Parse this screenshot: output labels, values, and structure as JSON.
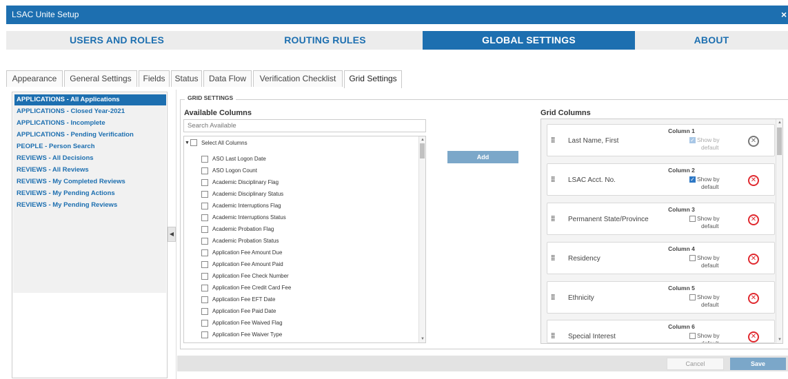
{
  "window": {
    "title": "LSAC Unite Setup",
    "close_glyph": "×"
  },
  "nav": {
    "users_roles": "USERS AND ROLES",
    "routing_rules": "ROUTING RULES",
    "global_settings": "GLOBAL SETTINGS",
    "about": "ABOUT",
    "active": "GLOBAL SETTINGS"
  },
  "tabs": [
    "Appearance",
    "General Settings",
    "Fields",
    "Status",
    "Data Flow",
    "Verification Checklist",
    "Grid Settings"
  ],
  "active_tab": "Grid Settings",
  "sidebar": {
    "items": [
      "APPLICATIONS - All Applications",
      "APPLICATIONS - Closed Year-2021",
      "APPLICATIONS - Incomplete",
      "APPLICATIONS - Pending Verification",
      "PEOPLE - Person Search",
      "REVIEWS - All Decisions",
      "REVIEWS - All Reviews",
      "REVIEWS - My Completed Reviews",
      "REVIEWS - My Pending Actions",
      "REVIEWS - My Pending Reviews"
    ],
    "selected": "APPLICATIONS - All Applications"
  },
  "grid_settings": {
    "legend": "GRID SETTINGS",
    "available_title": "Available Columns",
    "search_placeholder": "Search Available",
    "select_all": "Select All Columns",
    "available_columns": [
      "ASO Last Logon Date",
      "ASO Logon Count",
      "Academic Disciplinary Flag",
      "Academic Disciplinary Status",
      "Academic Interruptions Flag",
      "Academic Interruptions Status",
      "Academic Probation Flag",
      "Academic Probation Status",
      "Application Fee Amount Due",
      "Application Fee Amount Paid",
      "Application Fee Check Number",
      "Application Fee Credit Card Fee",
      "Application Fee EFT Date",
      "Application Fee Paid Date",
      "Application Fee Waived Flag",
      "Application Fee Waiver Type"
    ],
    "add_label": "Add",
    "grid_title": "Grid Columns",
    "show_by_line1": "Show by",
    "show_by_line2": "default",
    "grid_columns": [
      {
        "heading": "Column 1",
        "name": "Last Name, First",
        "show_by_default": true,
        "locked": true
      },
      {
        "heading": "Column 2",
        "name": "LSAC Acct. No.",
        "show_by_default": true,
        "locked": false
      },
      {
        "heading": "Column 3",
        "name": "Permanent State/Province",
        "show_by_default": false,
        "locked": false
      },
      {
        "heading": "Column 4",
        "name": "Residency",
        "show_by_default": false,
        "locked": false
      },
      {
        "heading": "Column 5",
        "name": "Ethnicity",
        "show_by_default": false,
        "locked": false
      },
      {
        "heading": "Column 6",
        "name": "Special Interest",
        "show_by_default": false,
        "locked": false
      }
    ]
  },
  "footer": {
    "cancel_label": "Cancel",
    "save_label": "Save"
  },
  "colors": {
    "primary": "#1d6fb0",
    "button_disabled": "#7ba7c9",
    "remove": "#e0282e"
  }
}
